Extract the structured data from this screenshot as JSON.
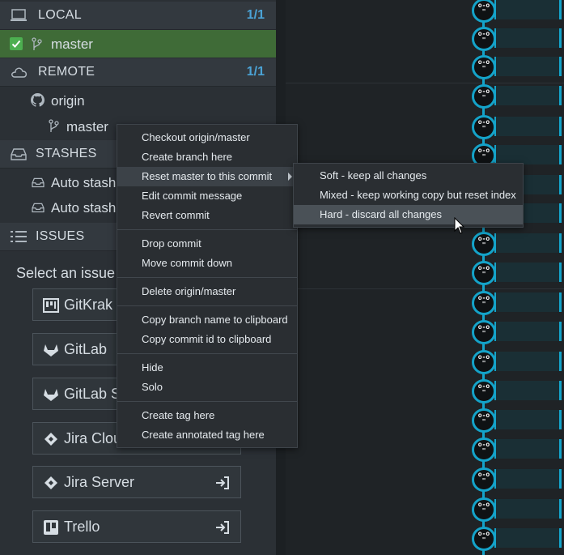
{
  "sidebar": {
    "local": {
      "title": "LOCAL",
      "count": "1/1",
      "branch": "master"
    },
    "remote": {
      "title": "REMOTE",
      "count": "1/1",
      "origin": "origin",
      "branch": "master"
    },
    "stashes": {
      "title": "STASHES",
      "items": [
        "Auto stash",
        "Auto stash"
      ]
    },
    "issues": {
      "title": "ISSUES",
      "intro": "Select an issue",
      "providers": [
        {
          "label": "GitKrak"
        },
        {
          "label": "GitLab"
        },
        {
          "label": "GitLab S"
        },
        {
          "label": "Jira Clou"
        },
        {
          "label": "Jira Server"
        },
        {
          "label": "Trello"
        }
      ]
    }
  },
  "context_menu": {
    "groups": [
      [
        "Checkout origin/master",
        "Create branch here",
        "Reset master to this commit",
        "Edit commit message",
        "Revert commit"
      ],
      [
        "Drop commit",
        "Move commit down"
      ],
      [
        "Delete origin/master"
      ],
      [
        "Copy branch name to clipboard",
        "Copy commit id to clipboard"
      ],
      [
        "Hide",
        "Solo"
      ],
      [
        "Create tag here",
        "Create annotated tag here"
      ]
    ],
    "active_item": "Reset master to this commit",
    "submenu": {
      "items": [
        "Soft - keep all changes",
        "Mixed - keep working copy but reset index",
        "Hard - discard all changes"
      ],
      "highlighted": "Hard - discard all changes"
    }
  },
  "graph": {
    "node_face": "o-o\n\"",
    "accent": "#14a3c9"
  },
  "colors": {
    "selected_branch": "#3f6b37",
    "count": "#4ba3d6",
    "check": "#4caf50"
  }
}
